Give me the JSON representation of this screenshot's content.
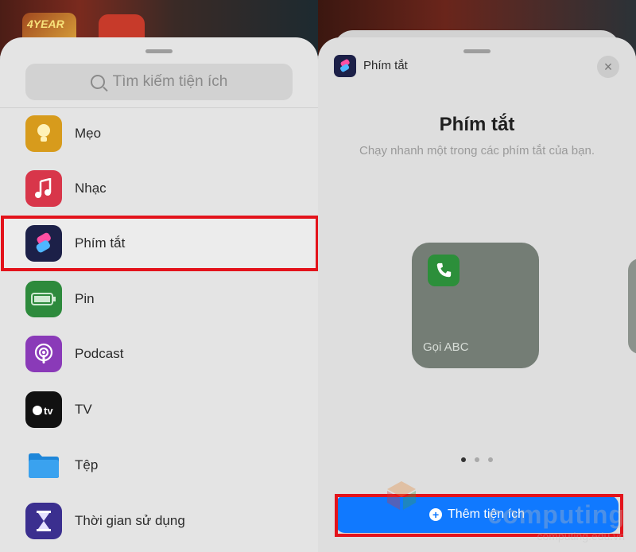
{
  "left": {
    "search_placeholder": "Tìm kiếm tiện ích",
    "items": [
      {
        "label": "Mẹo",
        "icon": "lightbulb-icon",
        "color": "#d79b1c"
      },
      {
        "label": "Nhạc",
        "icon": "music-note-icon",
        "color": "#d8364a"
      },
      {
        "label": "Phím tắt",
        "icon": "shortcuts-icon",
        "color": "#1c2048"
      },
      {
        "label": "Pin",
        "icon": "battery-icon",
        "color": "#2d8a3c"
      },
      {
        "label": "Podcast",
        "icon": "podcast-icon",
        "color": "#8a3ab8"
      },
      {
        "label": "TV",
        "icon": "apple-tv-icon",
        "color": "#111111"
      },
      {
        "label": "Tệp",
        "icon": "folder-icon",
        "color": "#1e86d9"
      },
      {
        "label": "Thời gian sử dụng",
        "icon": "hourglass-icon",
        "color": "#3b2f8f"
      }
    ],
    "background_thumb_text": "4YEAR"
  },
  "right": {
    "app_name": "Phím tắt",
    "title": "Phím tắt",
    "subtitle": "Chạy nhanh một trong các phím tắt của bạn.",
    "widget_label": "Gọi ABC",
    "page_dots": {
      "count": 3,
      "active": 0
    },
    "add_button_label": "Thêm tiện ích",
    "accent": "#1079ff"
  },
  "watermark": {
    "brand": "computing",
    "url": "computing.edu.vn"
  }
}
